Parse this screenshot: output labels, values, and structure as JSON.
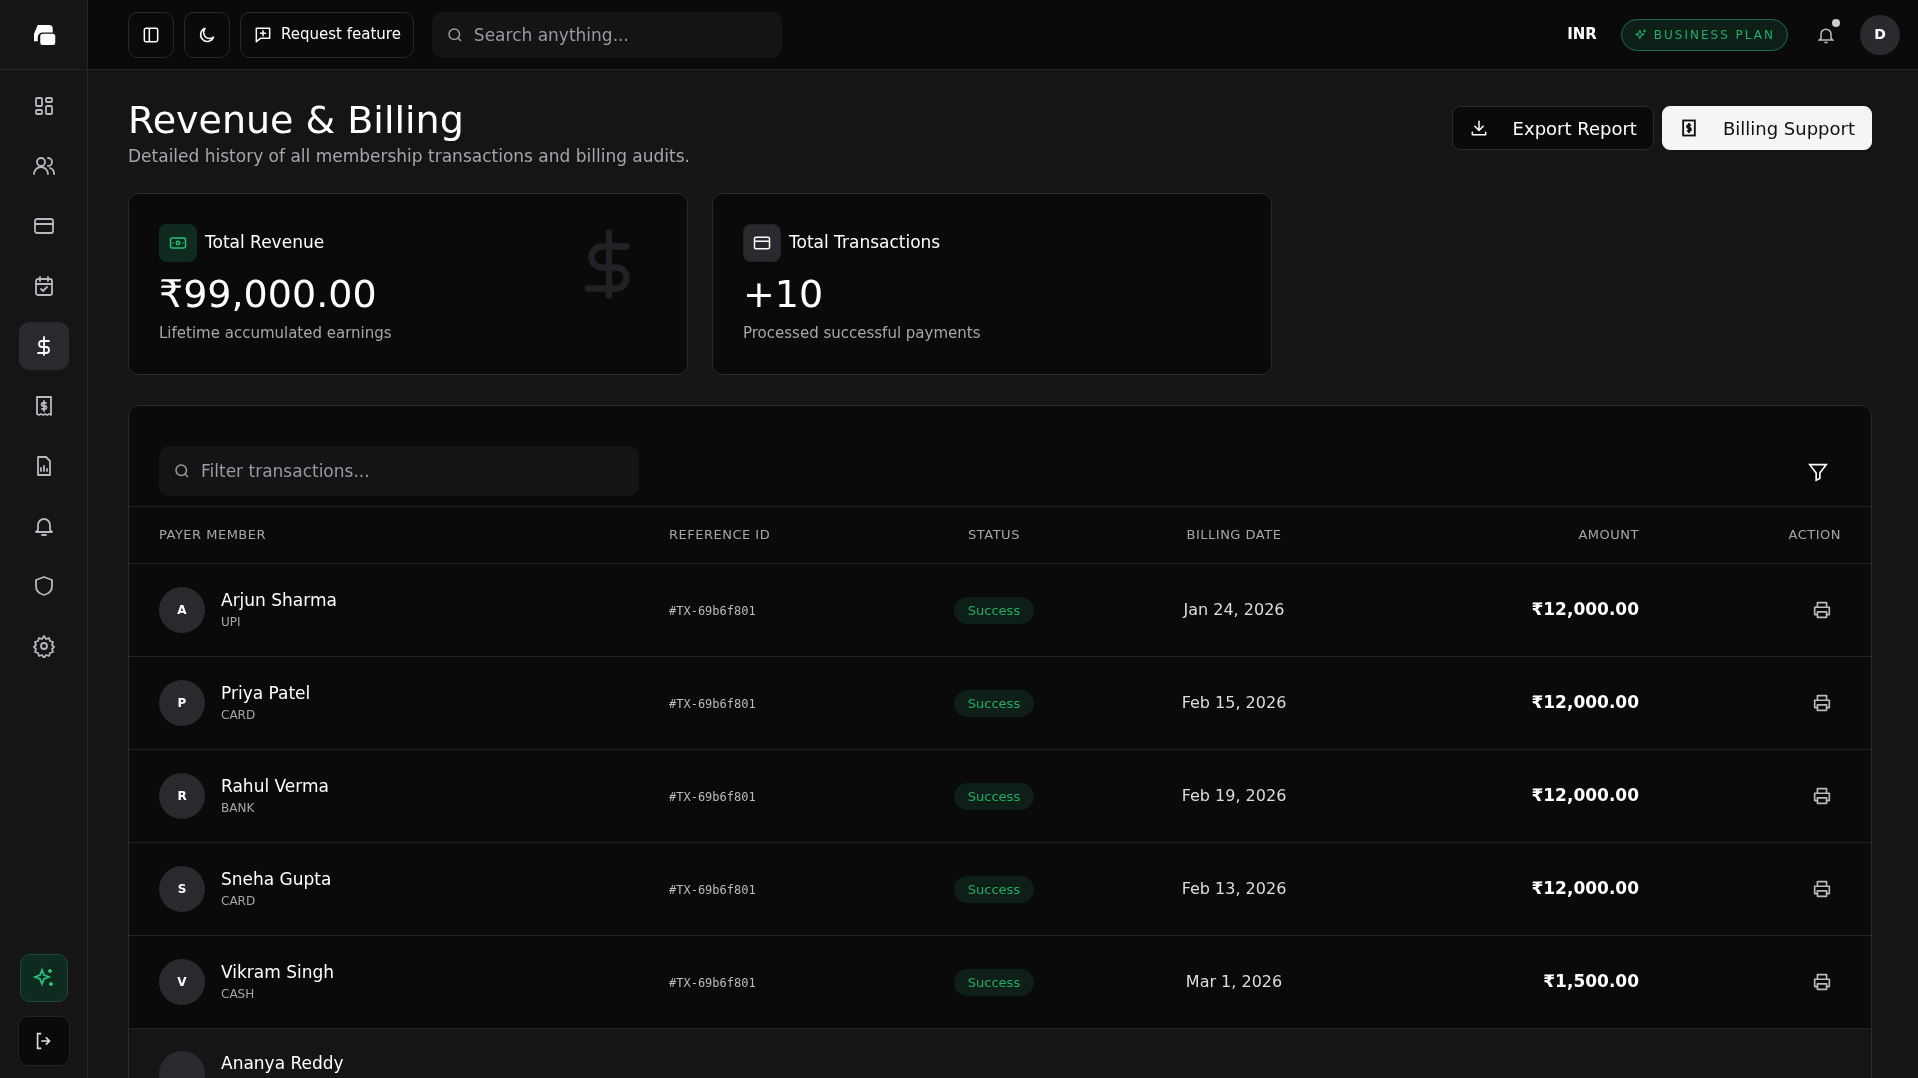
{
  "sidebar": {
    "items": [
      {
        "selected": false
      },
      {
        "selected": false
      },
      {
        "selected": false
      },
      {
        "selected": false
      },
      {
        "selected": true
      },
      {
        "selected": false
      },
      {
        "selected": false
      },
      {
        "selected": false
      },
      {
        "selected": false
      },
      {
        "selected": false
      }
    ]
  },
  "topbar": {
    "request_button": "Request feature",
    "search": {
      "placeholder": "Search anything..."
    },
    "currency": "INR",
    "plan_badge": "BUSINESS PLAN",
    "notification_dot": true,
    "avatar": "D"
  },
  "header": {
    "title": "Revenue & Billing",
    "subtitle": "Detailed history of all membership transactions and billing audits.",
    "buttons": [
      {
        "label": "Export Report",
        "kind": "dark"
      },
      {
        "label": "Billing Support",
        "kind": "light"
      }
    ]
  },
  "stats": [
    {
      "title": "Total Revenue",
      "value": "₹99,000.00",
      "caption": "Lifetime accumulated earnings",
      "watermark": true
    },
    {
      "title": "Total Transactions",
      "value": "+10",
      "caption": "Processed successful payments",
      "watermark": false
    }
  ],
  "table": {
    "filter": {
      "placeholder": "Filter transactions..."
    },
    "columns": [
      "PAYER MEMBER",
      "REFERENCE ID",
      "STATUS",
      "BILLING DATE",
      "AMOUNT",
      "ACTION"
    ],
    "rows": [
      {
        "initial": "A",
        "name": "Arjun Sharma",
        "method": "UPI",
        "reference": "#TX-69b6f801",
        "status": "Success",
        "date": "Jan 24, 2026",
        "amount": "₹12,000.00"
      },
      {
        "initial": "P",
        "name": "Priya Patel",
        "method": "CARD",
        "reference": "#TX-69b6f801",
        "status": "Success",
        "date": "Feb 15, 2026",
        "amount": "₹12,000.00"
      },
      {
        "initial": "R",
        "name": "Rahul Verma",
        "method": "BANK",
        "reference": "#TX-69b6f801",
        "status": "Success",
        "date": "Feb 19, 2026",
        "amount": "₹12,000.00"
      },
      {
        "initial": "S",
        "name": "Sneha Gupta",
        "method": "CARD",
        "reference": "#TX-69b6f801",
        "status": "Success",
        "date": "Feb 13, 2026",
        "amount": "₹12,000.00"
      },
      {
        "initial": "V",
        "name": "Vikram Singh",
        "method": "CASH",
        "reference": "#TX-69b6f801",
        "status": "Success",
        "date": "Mar 1, 2026",
        "amount": "₹1,500.00"
      }
    ],
    "partial_row": {
      "name": "Ananya Reddy",
      "hovered": true
    }
  }
}
